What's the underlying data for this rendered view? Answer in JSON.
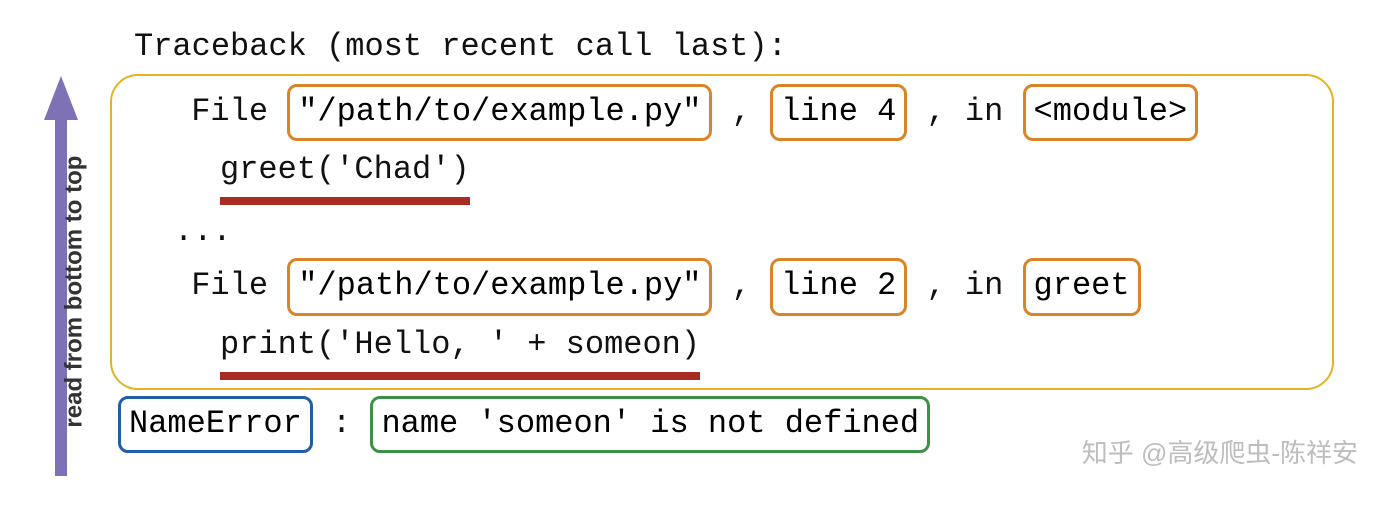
{
  "arrow_label": "read from bottom to top",
  "header": "Traceback (most recent call last):",
  "ellipsis": "...",
  "frames": [
    {
      "prefix": "File ",
      "path": "\"/path/to/example.py\"",
      "sep1": ", ",
      "line_word": "line 4",
      "sep2": ", in ",
      "func": "<module>",
      "source": "greet('Chad')"
    },
    {
      "prefix": "File ",
      "path": "\"/path/to/example.py\"",
      "sep1": ", ",
      "line_word": "line 2",
      "sep2": ", in ",
      "func": "greet",
      "source": "print('Hello, ' + someon)"
    }
  ],
  "exception": {
    "type": "NameError",
    "colon": ": ",
    "message": "name 'someon' is not defined"
  },
  "watermark": "知乎 @高级爬虫-陈祥安",
  "colors": {
    "frame_box": "#e6b122",
    "token_box": "#d88428",
    "exc_type_box": "#205ea8",
    "exc_msg_box": "#3e8f47",
    "underline": "#a72d22",
    "arrow": "#7e71b5"
  }
}
